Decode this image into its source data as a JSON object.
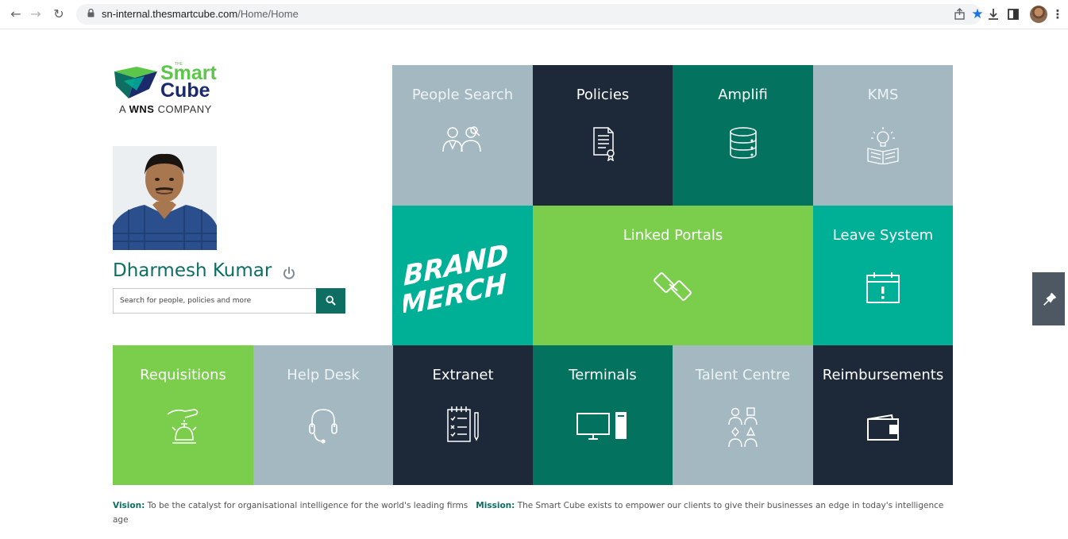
{
  "browser": {
    "url_host": "sn-internal.thesmartcube.com",
    "url_path": "/Home/Home",
    "icons": [
      "back-icon",
      "forward-icon",
      "reload-icon",
      "lock-icon",
      "share-icon",
      "star-icon",
      "download-icon",
      "sidepanel-icon",
      "profile-avatar",
      "menu-icon"
    ]
  },
  "logo": {
    "the": "THE",
    "smart": "Smart",
    "cube": "Cube",
    "company_prefix": "A",
    "company_brand": "WNS",
    "company_suffix": "COMPANY"
  },
  "user": {
    "name": "Dharmesh Kumar"
  },
  "search": {
    "placeholder": "Search for people, policies and more",
    "value": ""
  },
  "tiles": {
    "people_search": "People Search",
    "policies": "Policies",
    "amplifi": "Amplifi",
    "kms": "KMS",
    "brand_merch_line1": "BRAND",
    "brand_merch_line2": "MERCH",
    "linked_portals": "Linked Portals",
    "leave_system": "Leave System",
    "requisitions": "Requisitions",
    "help_desk": "Help Desk",
    "extranet": "Extranet",
    "terminals": "Terminals",
    "talent_centre": "Talent Centre",
    "reimbursements": "Reimbursements"
  },
  "footer": {
    "vision_label": "Vision:",
    "vision_text": "To be the catalyst for organisational intelligence for the world's leading firms",
    "mission_label": "Mission:",
    "mission_text": "The Smart Cube exists to empower our clients to give their businesses an edge in today's intelligence age"
  },
  "colors": {
    "grey": "#a3b8c0",
    "navy": "#1d2838",
    "dark_teal": "#03725f",
    "teal": "#00b096",
    "green": "#7bce4c",
    "accent": "#0e6e61"
  }
}
